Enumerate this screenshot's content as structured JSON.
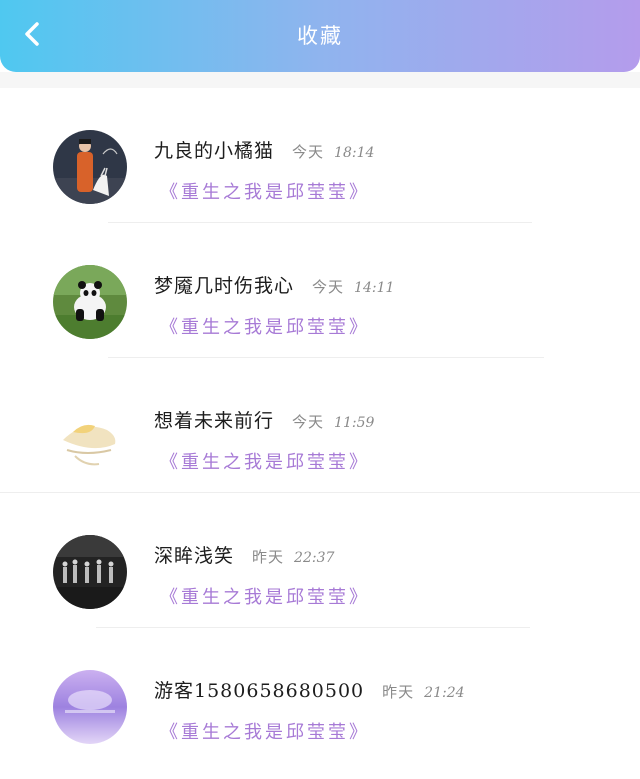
{
  "header": {
    "title": "收藏",
    "back_icon": "chevron-left-icon"
  },
  "colors": {
    "gradient_start": "#4fc8f0",
    "gradient_end": "#b49cec",
    "book_title": "#a77ad6"
  },
  "items": [
    {
      "name": "九良的小橘猫",
      "day": "今天",
      "time": "18:14",
      "book": "《重生之我是邱莹莹》"
    },
    {
      "name": "梦魇几时伤我心",
      "day": "今天",
      "time": "14:11",
      "book": "《重生之我是邱莹莹》"
    },
    {
      "name": "想着未来前行",
      "day": "今天",
      "time": "11:59",
      "book": "《重生之我是邱莹莹》"
    },
    {
      "name": "深眸浅笑",
      "day": "昨天",
      "time": "22:37",
      "book": "《重生之我是邱莹莹》"
    },
    {
      "name": "游客1580658680500",
      "day": "昨天",
      "time": "21:24",
      "book": "《重生之我是邱莹莹》"
    }
  ]
}
